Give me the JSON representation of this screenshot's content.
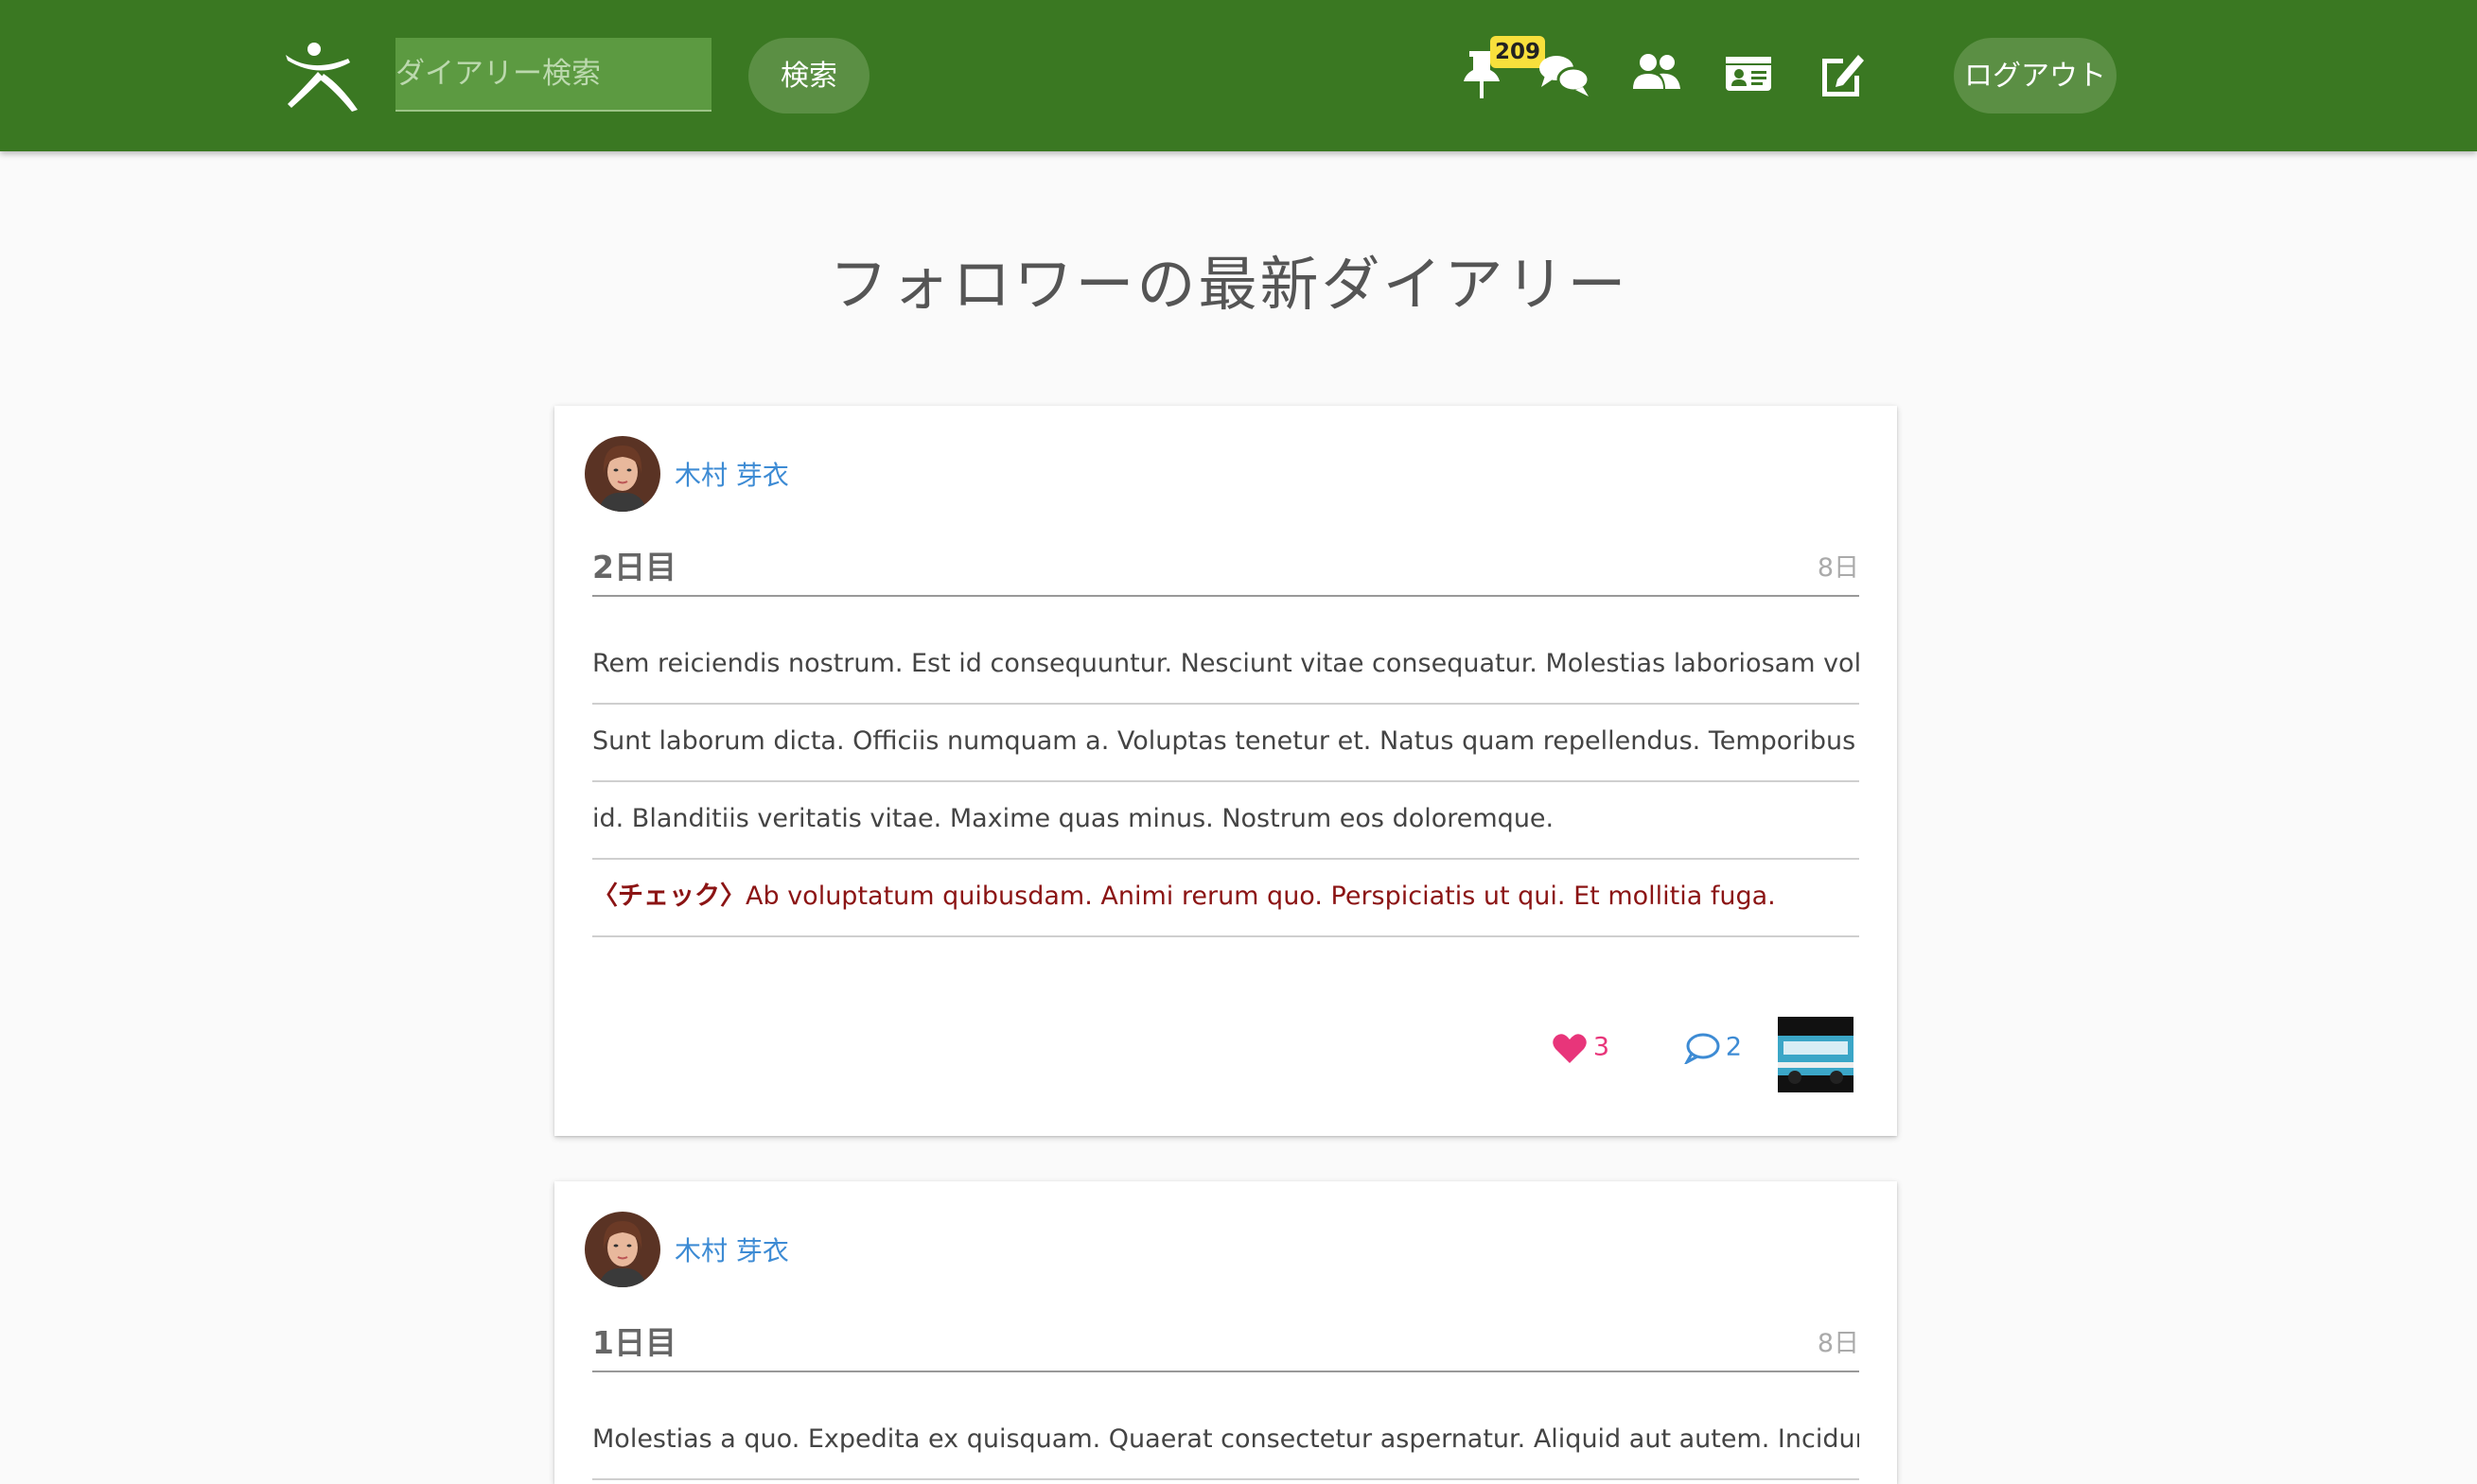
{
  "header": {
    "search_placeholder": "ダイアリー検索",
    "search_button": "検索",
    "notification_count": "209",
    "logout_button": "ログアウト",
    "icons": [
      "logo-icon",
      "pin-icon",
      "chat-icon",
      "users-icon",
      "id-card-icon",
      "edit-icon"
    ],
    "brand_color": "#3a7822"
  },
  "page": {
    "title": "フォロワーの最新ダイアリー"
  },
  "diaries": [
    {
      "author": "木村 芽衣",
      "title": "2日目",
      "date": "8日",
      "lines": [
        "Rem reiciendis nostrum. Est id consequuntur. Nesciunt vitae consequatur. Molestias laboriosam voluptatem.",
        "Sunt laborum dicta. Officiis numquam a. Voluptas tenetur et. Natus quam repellendus. Temporibus veniam",
        "id. Blanditiis veritatis vitae. Maxime quas minus. Nostrum eos doloremque."
      ],
      "check_label": "〈チェック〉",
      "check_text": "Ab voluptatum quibusdam. Animi rerum quo. Perspiciatis ut qui. Et mollitia fuga.",
      "likes": "3",
      "comments": "2",
      "like_color": "#e8357a",
      "comment_color": "#3d8bd4"
    },
    {
      "author": "木村 芽衣",
      "title": "1日目",
      "date": "8日",
      "lines": [
        "Molestias a quo. Expedita ex quisquam. Quaerat consectetur aspernatur. Aliquid aut autem. Incidunt ipsa et."
      ]
    }
  ]
}
